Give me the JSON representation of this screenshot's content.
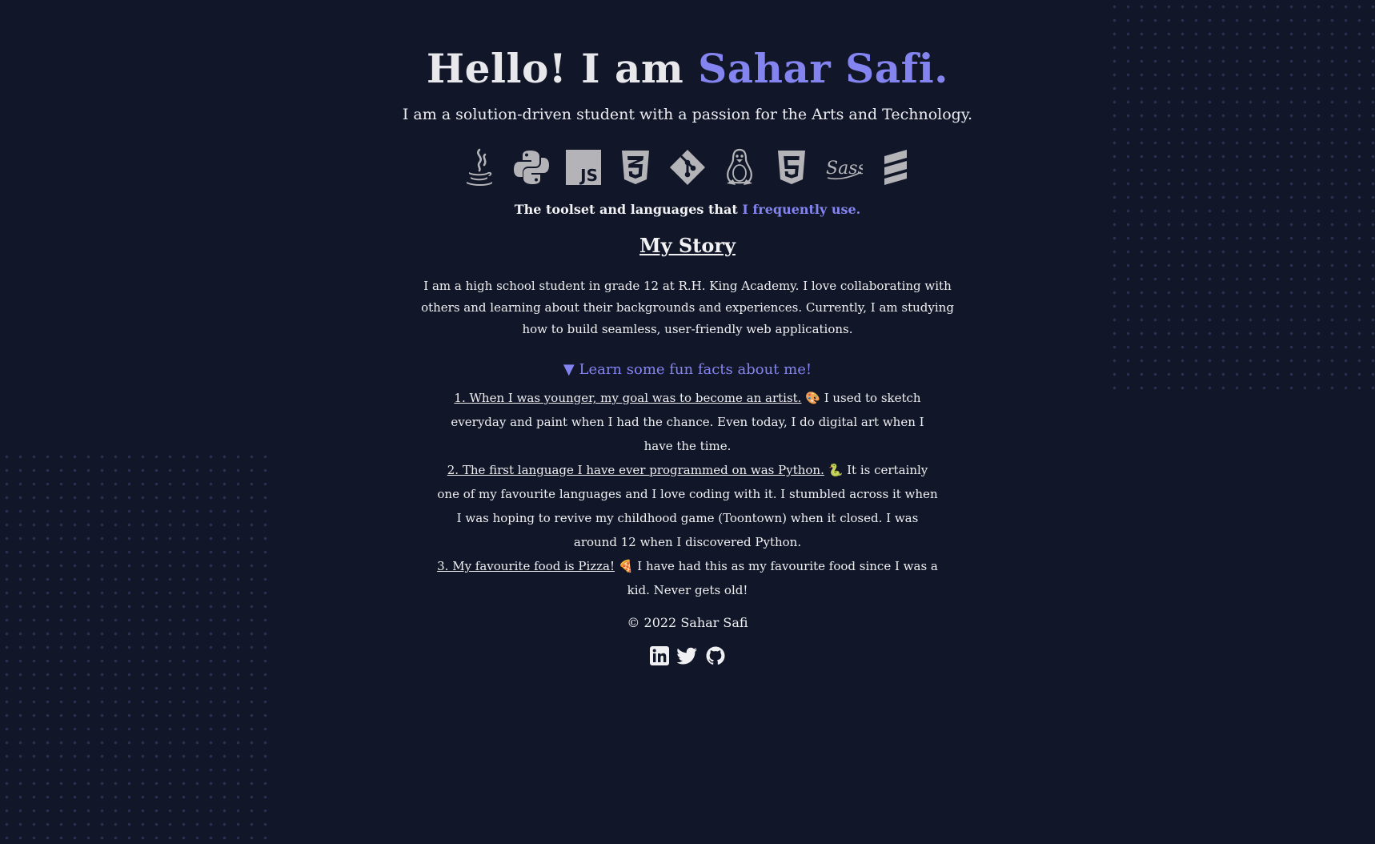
{
  "hero": {
    "greeting": "Hello! I am ",
    "name": "Sahar Safi.",
    "subtitle": "I am a solution-driven student with a passion for the Arts and Technology."
  },
  "tech_icons": [
    "java-icon",
    "python-icon",
    "javascript-icon",
    "css3-icon",
    "git-icon",
    "linux-icon",
    "html5-icon",
    "sass-icon",
    "database-stack-icon"
  ],
  "toolset": {
    "prefix": "The toolset and languages that ",
    "accent": "I frequently use."
  },
  "story": {
    "title": "My Story",
    "body": "I am a high school student in grade 12 at R.H. King Academy. I love collaborating with others and learning about their backgrounds and experiences. Currently, I am studying how to build seamless, user-friendly web applications."
  },
  "fun_facts": {
    "summary_marker": "▼",
    "summary": "Learn some fun facts about me!",
    "items": [
      {
        "head": "1. When I was younger, my goal was to become an artist.",
        "emoji": "🎨",
        "text": " I used to sketch everyday and paint when I had the chance. Even today, I do digital art when I have the time."
      },
      {
        "head": "2. The first language I have ever programmed on was Python.",
        "emoji": "🐍",
        "text": " It is certainly one of my favourite languages and I love coding with it. I stumbled across it when I was hoping to revive my childhood game (Toontown) when it closed. I was around 12 when I discovered Python."
      },
      {
        "head": "3. My favourite food is Pizza!",
        "emoji": "🍕",
        "text": " I have had this as my favourite food since I was a kid. Never gets old!"
      }
    ]
  },
  "footer": {
    "copyright": "© 2022 Sahar Safi",
    "socials": [
      "linkedin-icon",
      "twitter-icon",
      "github-icon"
    ]
  },
  "colors": {
    "background": "#111729",
    "accent": "#8484f0",
    "icon": "#b4b4b8"
  }
}
